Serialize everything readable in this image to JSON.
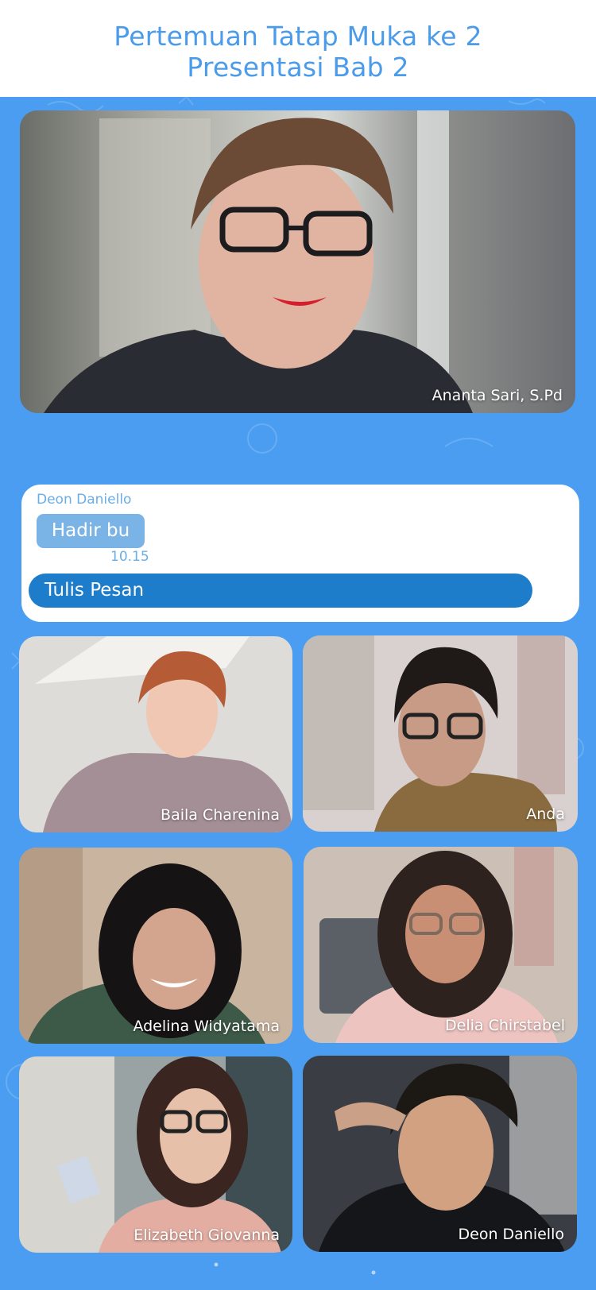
{
  "header": {
    "title_line1": "Pertemuan Tatap Muka ke 2",
    "title_line2": "Presentasi Bab 2"
  },
  "teacher": {
    "name": "Ananta Sari, S.Pd"
  },
  "chat": {
    "sender": "Deon Daniello",
    "message": "Hadir bu",
    "time": "10.15",
    "compose_placeholder": "Tulis Pesan"
  },
  "participants": [
    {
      "name": "Baila Charenina"
    },
    {
      "name": "Anda"
    },
    {
      "name": "Adelina Widyatama"
    },
    {
      "name": "Delia Chirstabel"
    },
    {
      "name": "Elizabeth Giovanna"
    },
    {
      "name": "Deon Daniello"
    }
  ],
  "colors": {
    "title": "#4a9bea",
    "stage_background": "#4a9df0",
    "chat_bubble": "#7ab3e6",
    "compose_bar": "#1e7dcb"
  }
}
